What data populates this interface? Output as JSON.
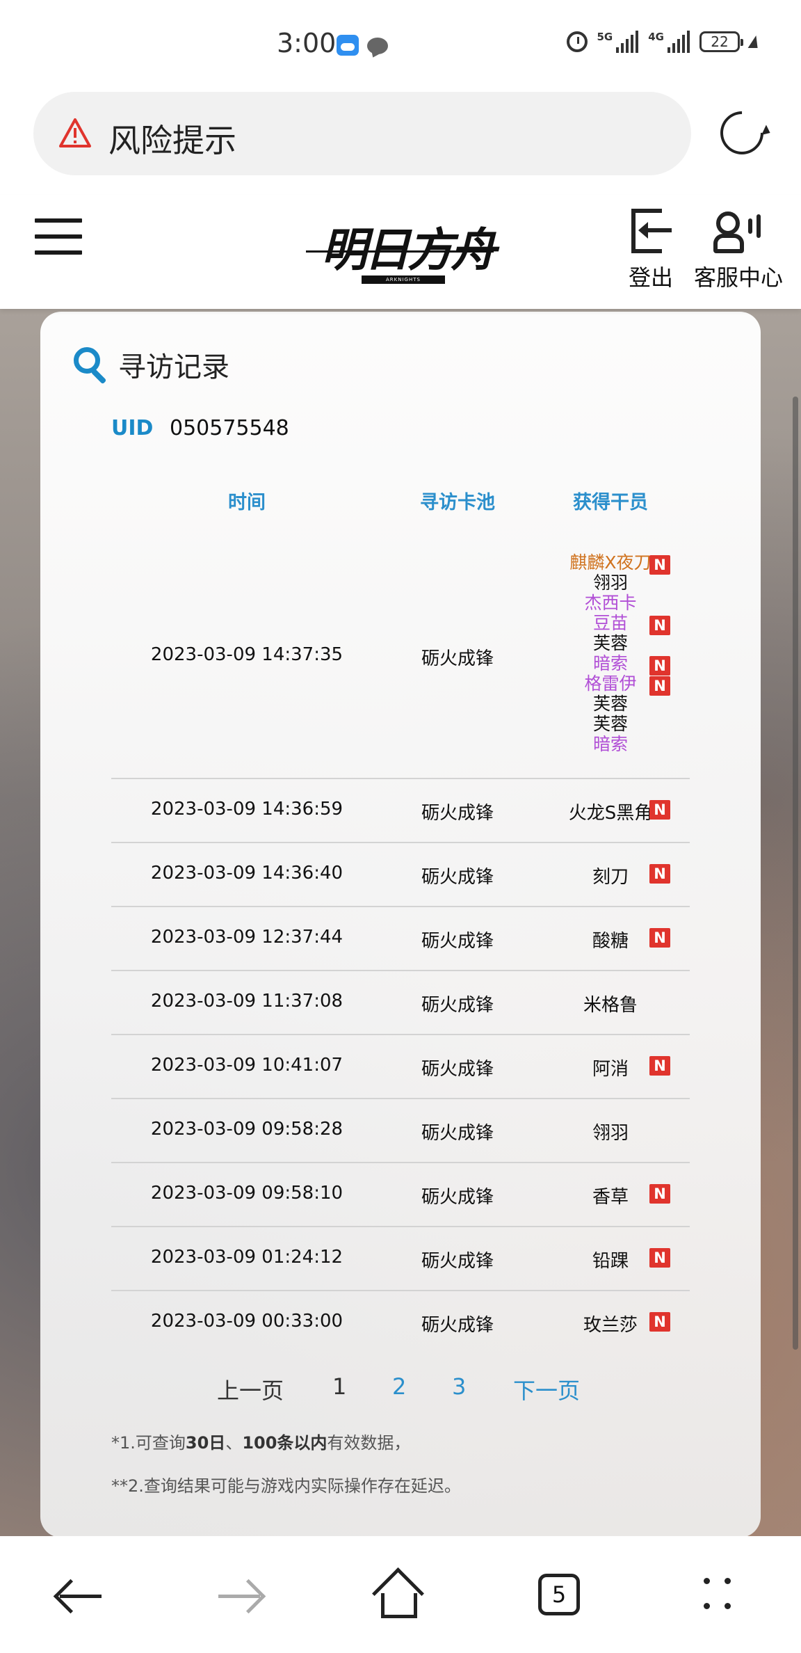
{
  "status_bar": {
    "time": "3:00",
    "net1": "5G",
    "net2": "4G",
    "battery": "22"
  },
  "address_bar": {
    "text": "风险提示",
    "warning_color": "#e0342d"
  },
  "header": {
    "logo_text": "明日方舟",
    "logo_sub": "ARKNIGHTS",
    "logout_label": "登出",
    "customer_service_label": "客服中心"
  },
  "card": {
    "title": "寻访记录",
    "uid_label": "UID",
    "uid_value": "050575548",
    "columns": [
      "时间",
      "寻访卡池",
      "获得干员"
    ],
    "accent_color": "#2b8fcc",
    "rows": [
      {
        "time": "2023-03-09 14:37:35",
        "pool": "砺火成锋",
        "operators": [
          {
            "name": "麒麟X夜刀",
            "rarity_color": "#d0731f",
            "new": true
          },
          {
            "name": "翎羽",
            "rarity_color": "#111111",
            "new": false
          },
          {
            "name": "杰西卡",
            "rarity_color": "#b14fd6",
            "new": false
          },
          {
            "name": "豆苗",
            "rarity_color": "#b14fd6",
            "new": true
          },
          {
            "name": "芙蓉",
            "rarity_color": "#111111",
            "new": false
          },
          {
            "name": "暗索",
            "rarity_color": "#b14fd6",
            "new": true
          },
          {
            "name": "格雷伊",
            "rarity_color": "#b14fd6",
            "new": true
          },
          {
            "name": "芙蓉",
            "rarity_color": "#111111",
            "new": false
          },
          {
            "name": "芙蓉",
            "rarity_color": "#111111",
            "new": false
          },
          {
            "name": "暗索",
            "rarity_color": "#b14fd6",
            "new": false
          }
        ]
      },
      {
        "time": "2023-03-09 14:36:59",
        "pool": "砺火成锋",
        "operator": "火龙S黑角",
        "rarity_color": "#cc9a18",
        "new": true
      },
      {
        "time": "2023-03-09 14:36:40",
        "pool": "砺火成锋",
        "operator": "刻刀",
        "rarity_color": "#b14fd6",
        "new": true
      },
      {
        "time": "2023-03-09 12:37:44",
        "pool": "砺火成锋",
        "operator": "酸糖",
        "rarity_color": "#b14fd6",
        "new": true
      },
      {
        "time": "2023-03-09 11:37:08",
        "pool": "砺火成锋",
        "operator": "米格鲁",
        "rarity_color": "#111111",
        "new": false
      },
      {
        "time": "2023-03-09 10:41:07",
        "pool": "砺火成锋",
        "operator": "阿消",
        "rarity_color": "#b14fd6",
        "new": true
      },
      {
        "time": "2023-03-09 09:58:28",
        "pool": "砺火成锋",
        "operator": "翎羽",
        "rarity_color": "#111111",
        "new": false
      },
      {
        "time": "2023-03-09 09:58:10",
        "pool": "砺火成锋",
        "operator": "香草",
        "rarity_color": "#111111",
        "new": true
      },
      {
        "time": "2023-03-09 01:24:12",
        "pool": "砺火成锋",
        "operator": "铅踝",
        "rarity_color": "#b14fd6",
        "new": true
      },
      {
        "time": "2023-03-09 00:33:00",
        "pool": "砺火成锋",
        "operator": "玫兰莎",
        "rarity_color": "#111111",
        "new": true
      }
    ],
    "new_badge": "N",
    "pagination": {
      "prev": "上一页",
      "pages": [
        "1",
        "2",
        "3"
      ],
      "current": "1",
      "next": "下一页"
    },
    "notes": {
      "note1_prefix": "*1.可查询",
      "note1_bold1": "30日",
      "note1_mid": "、",
      "note1_bold2": "100条以内",
      "note1_suffix": "有效数据，",
      "note2": "**2.查询结果可能与游戏内实际操作存在延迟。"
    }
  },
  "bottom_nav": {
    "tab_count": "5",
    "icons": [
      "back-arrow-icon",
      "forward-arrow-icon",
      "home-icon",
      "tabs-icon",
      "menu-dots-icon"
    ]
  }
}
